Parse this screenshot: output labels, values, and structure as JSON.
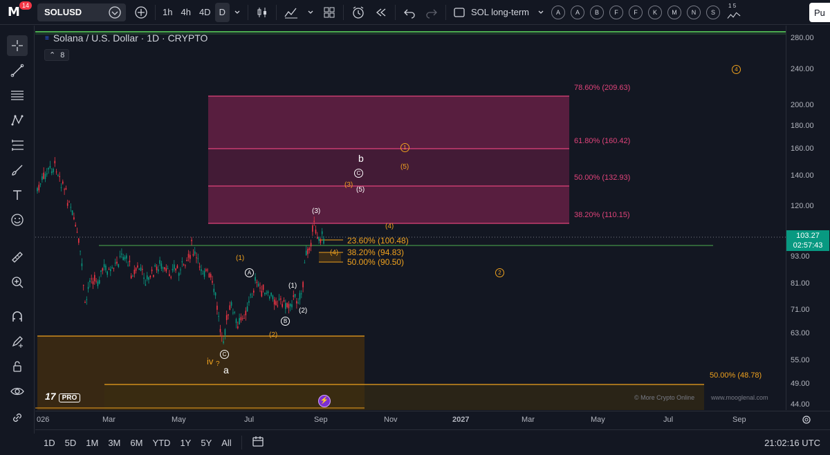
{
  "topbar": {
    "notifications": "14",
    "symbol": "SOLUSD",
    "intervals": [
      "1h",
      "4h",
      "4D",
      "D"
    ],
    "active_interval": "D",
    "layout_name": "SOL long-term",
    "letters": [
      "A",
      "A",
      "B",
      "F",
      "F",
      "K",
      "M",
      "N",
      "S"
    ],
    "alert_counts": "1 5",
    "publish": "Pu"
  },
  "legend": {
    "title": "Solana / U.S. Dollar · 1D · CRYPTO",
    "indicator_count": "8"
  },
  "price_axis": [
    "280.00",
    "240.00",
    "200.00",
    "180.00",
    "160.00",
    "140.00",
    "120.00",
    "103.27",
    "93.00",
    "81.00",
    "71.00",
    "63.00",
    "55.00",
    "49.00",
    "44.00"
  ],
  "current_price": {
    "price": "103.27",
    "countdown": "02:57:43"
  },
  "time_axis": [
    "026",
    "Mar",
    "May",
    "Jul",
    "Sep",
    "Nov",
    "2027",
    "Mar",
    "May",
    "Jul",
    "Sep"
  ],
  "fib_labels": {
    "f786": "78.60% (209.63)",
    "f618": "61.80% (160.42)",
    "f500": "50.00% (132.93)",
    "f382": "38.20% (110.15)",
    "o236": "23.60% (100.48)",
    "o382": "38.20% (94.83)",
    "o500": "50.00% (90.50)",
    "bottom50": "50.00% (48.78)"
  },
  "waves": {
    "b": "b",
    "a": "a",
    "iv": "iv",
    "q": "?",
    "C_upper": "C",
    "A": "A",
    "B": "B",
    "C_low": "C",
    "w1_paren": "(1)",
    "w1_w": "(1)",
    "w2_w": "(2)",
    "w3_w": "(3)",
    "w5_w": "(5)",
    "o2": "(2)",
    "o3": "(3)",
    "o4a": "(4)",
    "o4b": "(4)",
    "o5": "(5)",
    "c1": "1",
    "c2": "2",
    "c4": "4"
  },
  "watermarks": {
    "left": "© More Crypto Online",
    "right": "www.mooglenal.com"
  },
  "tv_logo": {
    "mark": "17",
    "pro": "PRO"
  },
  "bottombar": {
    "ranges": [
      "1D",
      "5D",
      "1M",
      "3M",
      "6M",
      "YTD",
      "1Y",
      "5Y",
      "All"
    ],
    "clock": "21:02:16 UTC"
  },
  "colors": {
    "up": "#089981",
    "down": "#f23645",
    "fib_pink": "#e0437a",
    "orange": "#f0a21e",
    "green_line": "#4caf50"
  }
}
